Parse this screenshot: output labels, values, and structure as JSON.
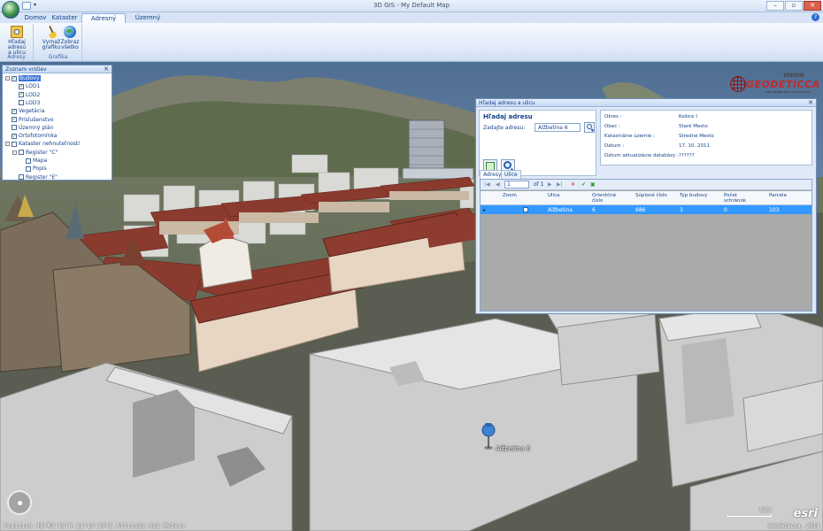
{
  "window": {
    "title": "3D GIS - My Default Map"
  },
  "ribbon": {
    "tabs": [
      {
        "label": "Domov",
        "active": false
      },
      {
        "label": "Kataster",
        "active": false
      },
      {
        "label": "Adresný systém",
        "active": true
      },
      {
        "label": "Územný plán",
        "active": false
      }
    ],
    "groups": [
      {
        "label": "Adresy",
        "buttons": [
          {
            "label1": "Hľadaj adresu",
            "label2": "a ulicu",
            "icon": "find-address-icon"
          }
        ]
      },
      {
        "label": "Grafika",
        "buttons": [
          {
            "label1": "Vymaž",
            "label2": "grafiku",
            "icon": "broom-icon"
          },
          {
            "label1": "Zobraz",
            "label2": "všetko",
            "icon": "globe-icon"
          }
        ]
      }
    ]
  },
  "layers": {
    "title": "Zoznam vrstiev",
    "items": [
      {
        "label": "Budovy",
        "checked": true,
        "level": 0,
        "expand": "-",
        "selected": true
      },
      {
        "label": "LOD1",
        "checked": true,
        "level": 1
      },
      {
        "label": "LOD2",
        "checked": true,
        "level": 1
      },
      {
        "label": "LOD3",
        "checked": false,
        "level": 1
      },
      {
        "label": "Vegetácia",
        "checked": true,
        "level": 0
      },
      {
        "label": "Príslušenstvo",
        "checked": true,
        "level": 0
      },
      {
        "label": "Územný plán",
        "checked": false,
        "level": 0
      },
      {
        "label": "Ortofotomínka",
        "checked": true,
        "level": 0
      },
      {
        "label": "Kataster nehnuteľností",
        "checked": false,
        "level": 0,
        "expand": "-"
      },
      {
        "label": "Register \"C\"",
        "checked": false,
        "level": 1,
        "expand": "-"
      },
      {
        "label": "Mapa",
        "checked": false,
        "level": 2
      },
      {
        "label": "Popis",
        "checked": false,
        "level": 2
      },
      {
        "label": "Register \"E\"",
        "checked": false,
        "level": 1
      }
    ]
  },
  "address_dialog": {
    "title": "Hľadaj adresu a ulicu",
    "search_title": "Hľadaj adresu",
    "search_label": "Zadajte adresu:",
    "search_value": "Alžbetina 6",
    "info": [
      {
        "key": "Okres :",
        "value": "Košice I"
      },
      {
        "key": "Obec :",
        "value": "Staré Mesto"
      },
      {
        "key": "Katastrálne územie :",
        "value": "Stredné Mesto"
      },
      {
        "key": "Dátum :",
        "value": "17. 10. 2011"
      },
      {
        "key": "Dátum aktualizácie databázy :",
        "value": "??????"
      }
    ],
    "tabs": [
      {
        "label": "Adresy",
        "active": true
      },
      {
        "label": "Ulice",
        "active": false
      }
    ],
    "pager": {
      "page": "1",
      "of": "of 1"
    },
    "columns": [
      "Zoom",
      "Ulica",
      "Orientčné číslo",
      "Súpisné číslo",
      "Typ budovy",
      "Počet schránok",
      "Parcela"
    ],
    "rows": [
      {
        "zoom": false,
        "ulica": "Alžbetina",
        "orient": "6",
        "supisne": "686",
        "typ": "3",
        "schranky": "0",
        "parcela": "103"
      }
    ]
  },
  "scene": {
    "pin_label": "Alžbetina 6",
    "status": "Position  48°43'15\"N  21°15'30\"E  Altitude  622 Meters",
    "copyright": "Geodeticca, 2011",
    "scale": "50m",
    "esri": "esri"
  },
  "brand": {
    "name": "GEODETICCA",
    "top": "VISION",
    "sub": "THE PREMIER NEW IN GEODETICA"
  },
  "colors": {
    "accent": "#3399ff",
    "ribbon": "#dfe9f7",
    "roof": "#8b3a2e"
  }
}
